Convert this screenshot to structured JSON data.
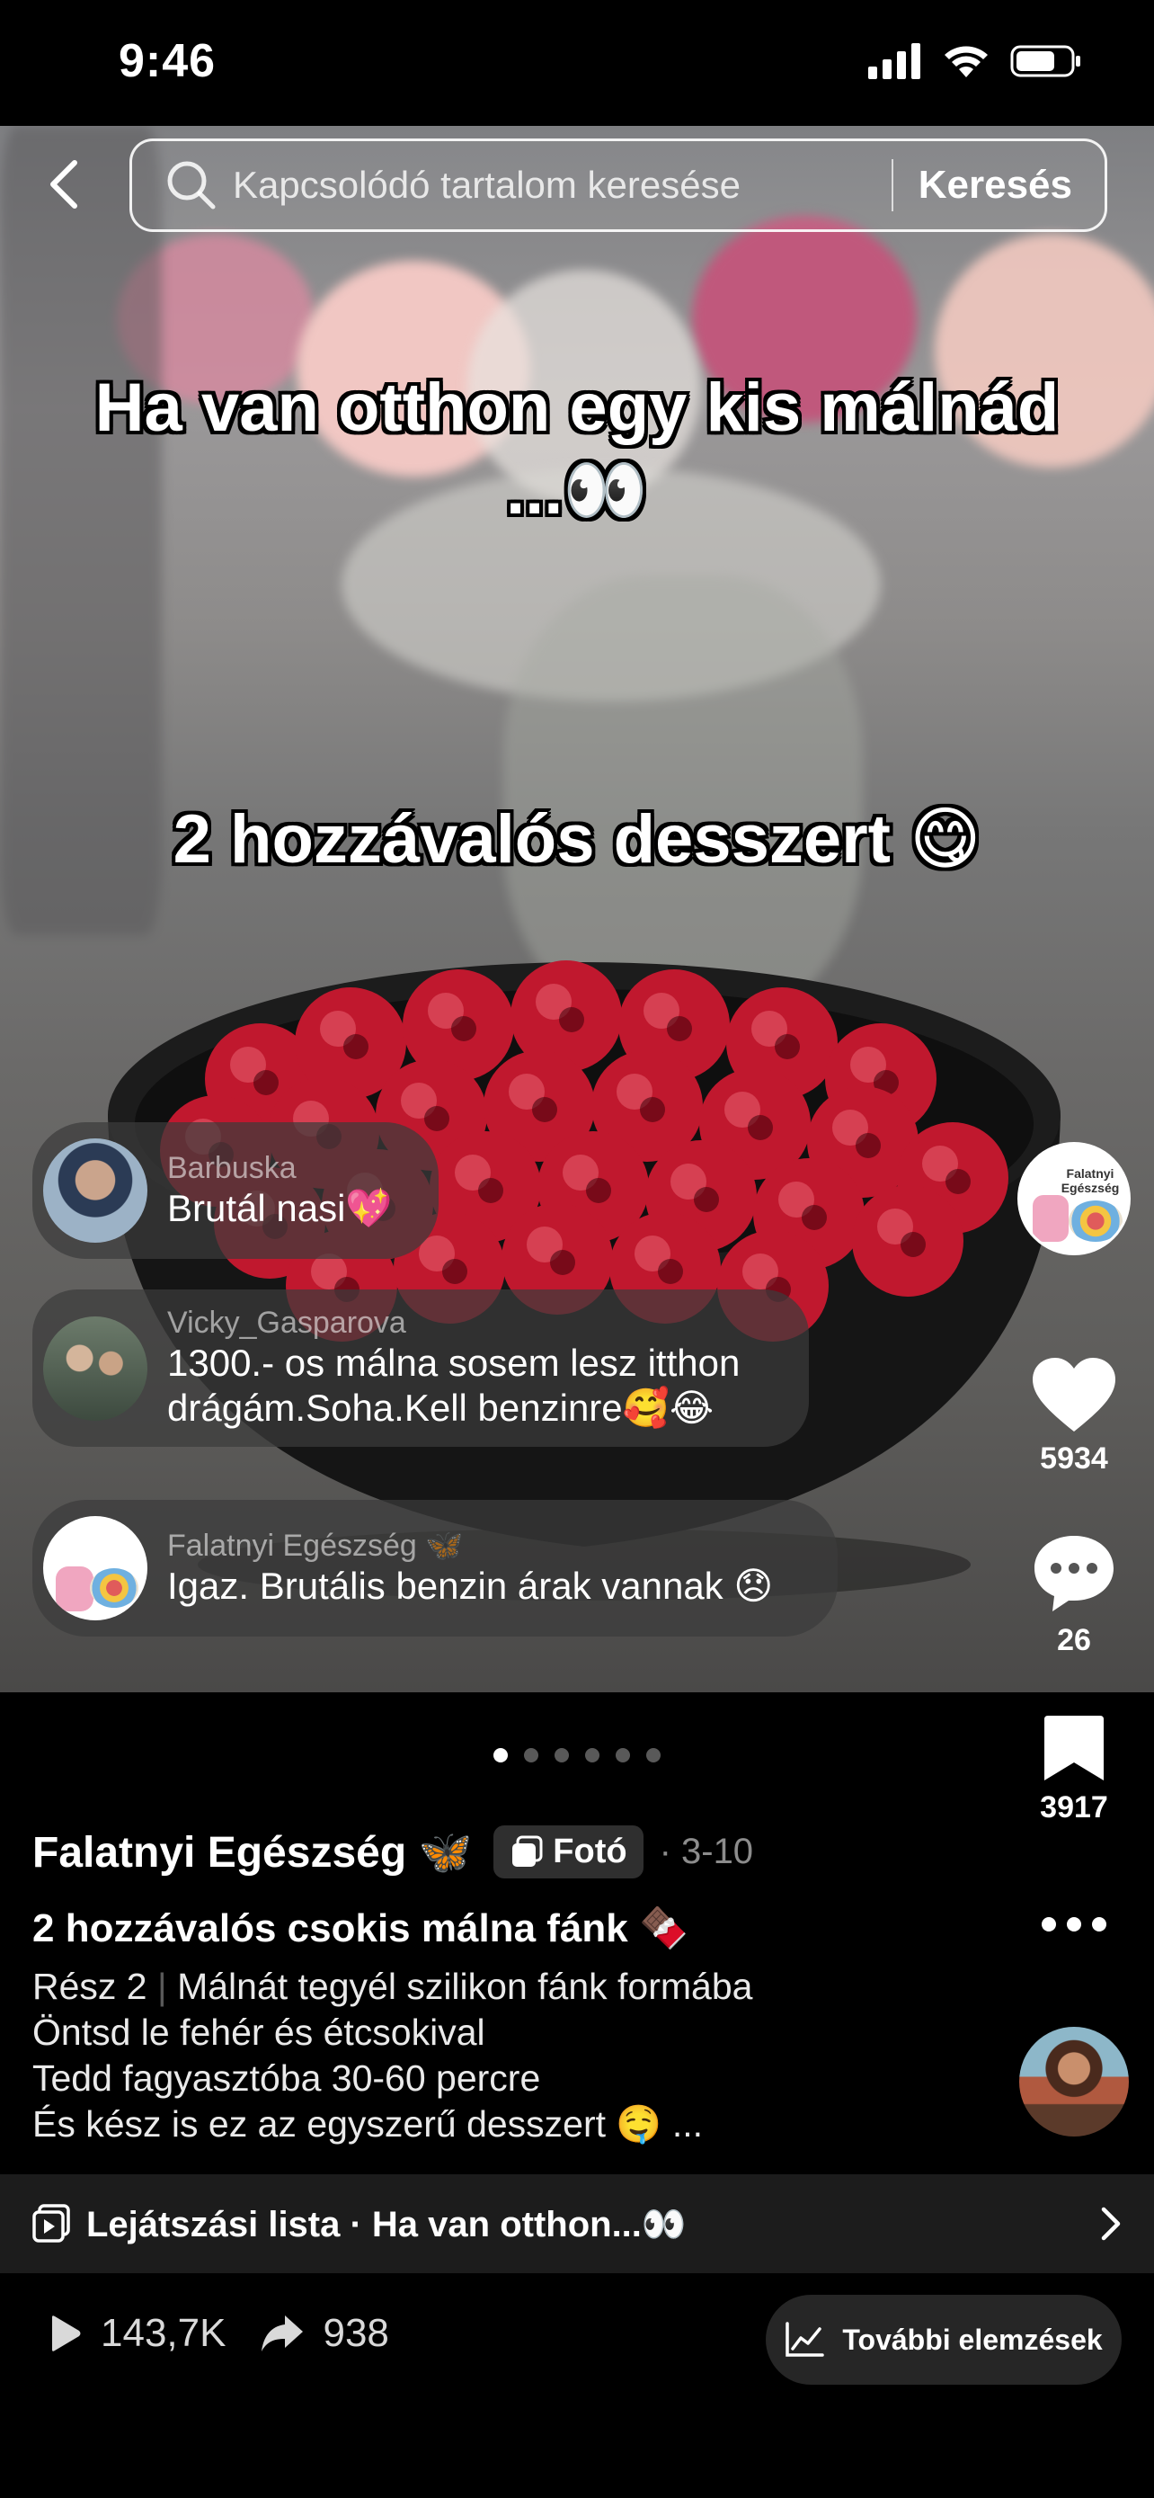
{
  "status_bar": {
    "time": "9:46"
  },
  "search": {
    "placeholder": "Kapcsolódó tartalom keresése",
    "submit_label": "Keresés"
  },
  "overlay": {
    "line1": "Ha van otthon egy kis málnád",
    "line2": "...👀",
    "subtitle": "2 hozzávalós desszert 😋"
  },
  "comments": [
    {
      "user": "Barbuska",
      "text": "Brutál nasi💖"
    },
    {
      "user": "Vicky_Gasparova",
      "text_line1": "1300.- os málna sosem lesz itthon",
      "text_line2": "drágám.Soha.Kell benzinre🥰😂"
    },
    {
      "user": "Falatnyi Egészség 🦋",
      "text": "Igaz. Brutális benzin árak vannak 😞"
    }
  ],
  "rail": {
    "profile_badge": "Falatnyi Egészség",
    "likes": "5934",
    "comments": "26",
    "saves": "3917"
  },
  "carousel": {
    "total": 6,
    "active": 0
  },
  "post": {
    "author": "Falatnyi Egészség 🦋",
    "type_badge": "Fotó",
    "date": "· 3-10",
    "title": "2 hozzávalós csokis málna fánk 🍫",
    "part": "Rész 2",
    "desc_line1": "Málnát tegyél szilikon fánk formába",
    "desc_line2": "Öntsd le fehér és étcsokival",
    "desc_line3": "Tedd fagyasztóba 30-60 percre",
    "desc_line4": "És kész is ez az egyszerű desszert 🤤 ..."
  },
  "playlist": {
    "label": "Lejátszási lista · Ha van otthon...👀"
  },
  "stats": {
    "views": "143,7K",
    "shares": "938"
  },
  "analytics": {
    "label": "További elemzések"
  },
  "colors": {
    "background": "#000000",
    "raspberry": "#c0182e",
    "accent_blue": "#3aa0ff"
  }
}
